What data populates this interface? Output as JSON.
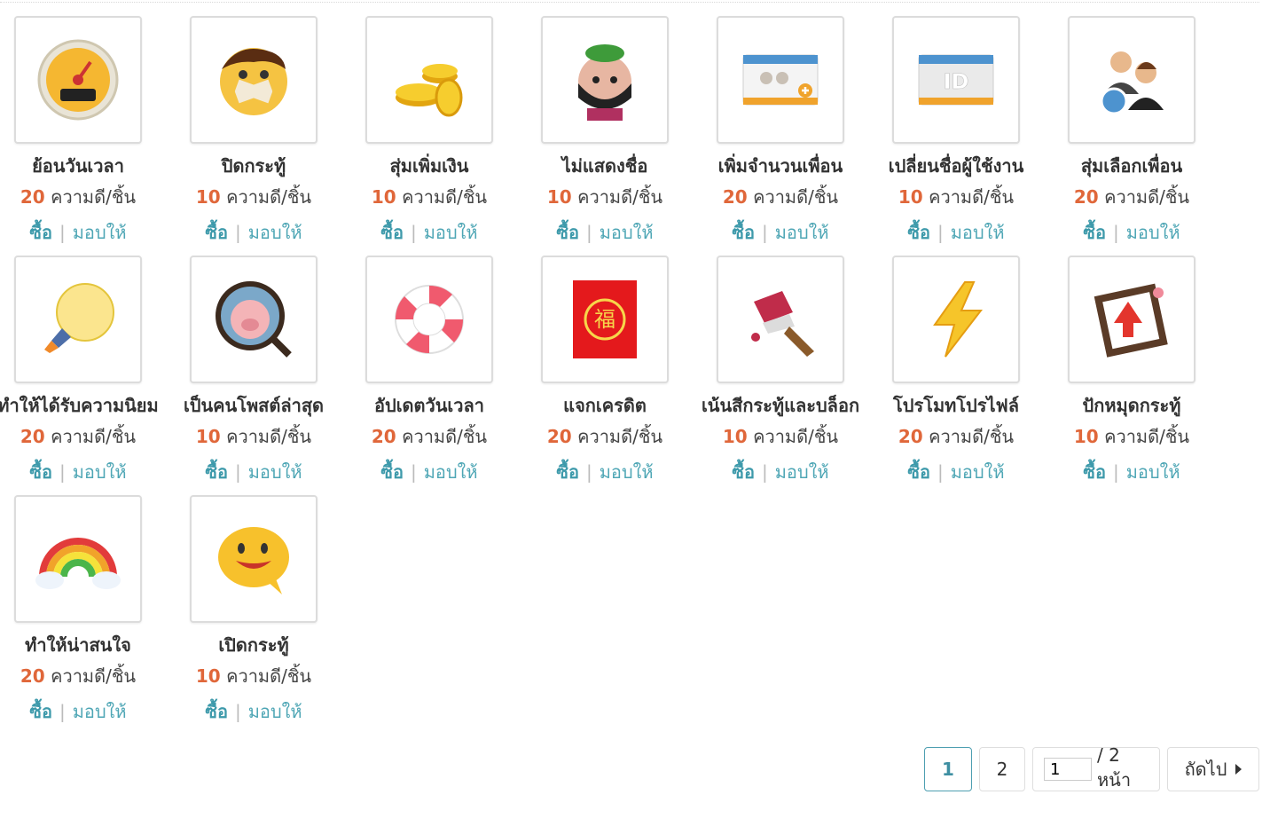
{
  "items": [
    {
      "name": "ย้อนวันเวลา",
      "price": "20",
      "unit": "ความดี/ชิ้น",
      "buy": "ซื้อ",
      "give": "มอบให้",
      "icon": "speedometer-icon"
    },
    {
      "name": "ปิดกระทู้",
      "price": "10",
      "unit": "ความดี/ชิ้น",
      "buy": "ซื้อ",
      "give": "มอบให้",
      "icon": "taped-mouth-face-icon"
    },
    {
      "name": "สุ่มเพิ่มเงิน",
      "price": "10",
      "unit": "ความดี/ชิ้น",
      "buy": "ซื้อ",
      "give": "มอบให้",
      "icon": "gold-coins-icon"
    },
    {
      "name": "ไม่แสดงชื่อ",
      "price": "10",
      "unit": "ความดี/ชิ้น",
      "buy": "ซื้อ",
      "give": "มอบให้",
      "icon": "masked-ninja-icon"
    },
    {
      "name": "เพิ่มจำนวนเพื่อน",
      "price": "20",
      "unit": "ความดี/ชิ้น",
      "buy": "ซื้อ",
      "give": "มอบให้",
      "icon": "add-friends-card-icon"
    },
    {
      "name": "เปลี่ยนชื่อผู้ใช้งาน",
      "price": "10",
      "unit": "ความดี/ชิ้น",
      "buy": "ซื้อ",
      "give": "มอบให้",
      "icon": "id-card-icon"
    },
    {
      "name": "สุ่มเลือกเพื่อน",
      "price": "20",
      "unit": "ความดี/ชิ้น",
      "buy": "ซื้อ",
      "give": "มอบให้",
      "icon": "user-swap-icon"
    },
    {
      "name": "ทำให้ได้รับความนิยม",
      "price": "20",
      "unit": "ความดี/ชิ้น",
      "buy": "ซื้อ",
      "give": "มอบให้",
      "icon": "light-bulb-icon"
    },
    {
      "name": "เป็นคนโพสต์ล่าสุด",
      "price": "10",
      "unit": "ความดี/ชิ้น",
      "buy": "ซื้อ",
      "give": "มอบให้",
      "icon": "pig-magnifier-icon"
    },
    {
      "name": "อัปเดตวันเวลา",
      "price": "20",
      "unit": "ความดี/ชิ้น",
      "buy": "ซื้อ",
      "give": "มอบให้",
      "icon": "life-ring-icon"
    },
    {
      "name": "แจกเครดิต",
      "price": "20",
      "unit": "ความดี/ชิ้น",
      "buy": "ซื้อ",
      "give": "มอบให้",
      "icon": "red-envelope-icon"
    },
    {
      "name": "เน้นสีกระทู้และบล็อก",
      "price": "10",
      "unit": "ความดี/ชิ้น",
      "buy": "ซื้อ",
      "give": "มอบให้",
      "icon": "paint-brush-icon"
    },
    {
      "name": "โปรโมทโปรไฟล์",
      "price": "20",
      "unit": "ความดี/ชิ้น",
      "buy": "ซื้อ",
      "give": "มอบให้",
      "icon": "lightning-icon"
    },
    {
      "name": "ปักหมุดกระทู้",
      "price": "10",
      "unit": "ความดี/ชิ้น",
      "buy": "ซื้อ",
      "give": "มอบให้",
      "icon": "pinned-note-icon"
    },
    {
      "name": "ทำให้น่าสนใจ",
      "price": "20",
      "unit": "ความดี/ชิ้น",
      "buy": "ซื้อ",
      "give": "มอบให้",
      "icon": "rainbow-icon"
    },
    {
      "name": "เปิดกระทู้",
      "price": "10",
      "unit": "ความดี/ชิ้น",
      "buy": "ซื้อ",
      "give": "มอบให้",
      "icon": "smiley-speech-bubble-icon"
    }
  ],
  "separator": "|",
  "pagination": {
    "current": "1",
    "page2": "2",
    "jump_value": "1",
    "total_label": "/ 2 หน้า",
    "next_label": "ถัดไป"
  },
  "colors": {
    "accent": "#3e9aab",
    "price": "#e0673a",
    "border": "#dcdcdc"
  }
}
